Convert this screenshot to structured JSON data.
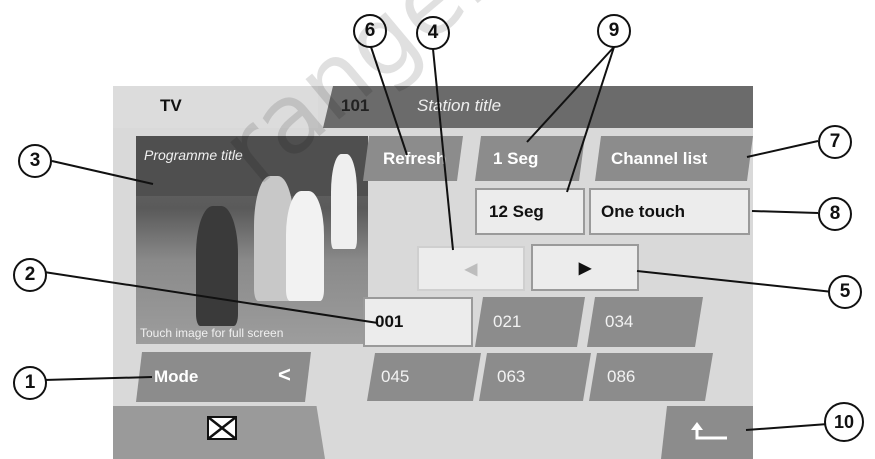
{
  "header": {
    "source_label": "TV",
    "channel_number": "101",
    "station_title": "Station title"
  },
  "preview": {
    "programme_title": "Programme title",
    "hint": "Touch image for full screen"
  },
  "buttons": {
    "refresh": "Refresh",
    "one_seg": "1 Seg",
    "twelve_seg": "12 Seg",
    "channel_list": "Channel list",
    "one_touch": "One touch",
    "mode": "Mode",
    "mode_chevron": "<",
    "prev_arrow": "◀",
    "next_arrow": "▶",
    "back": "↰"
  },
  "channels": [
    "001",
    "021",
    "034",
    "045",
    "063",
    "086"
  ],
  "callouts": [
    "1",
    "2",
    "3",
    "4",
    "5",
    "6",
    "7",
    "8",
    "9",
    "10"
  ],
  "watermark": "rangeroverclub.net",
  "icons": {
    "mail": "mail-icon",
    "back": "return-arrow-icon"
  },
  "colors": {
    "tile_grey": "#8c8c8c",
    "header_dark": "#6b6b6b",
    "screen_bg": "#d9d9d9"
  }
}
